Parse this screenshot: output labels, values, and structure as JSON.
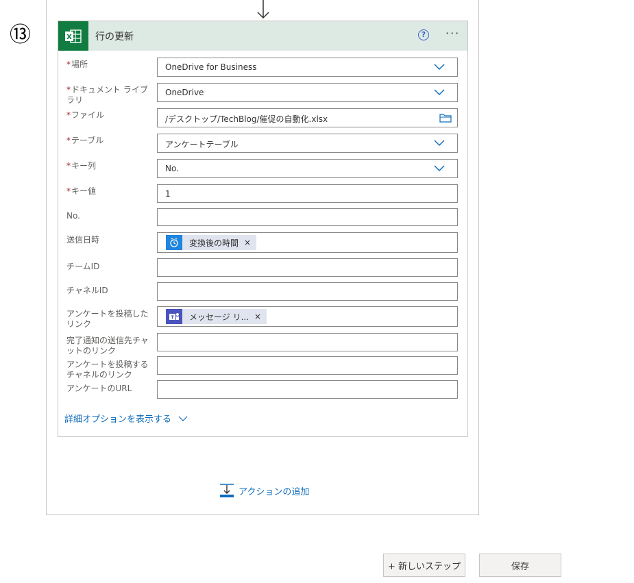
{
  "step_number": "⑬",
  "card": {
    "title": "行の更新",
    "help_label": "?",
    "more_label": "···"
  },
  "fields": {
    "location": {
      "label": "場所",
      "required_mark": "*",
      "value": "OneDrive for Business"
    },
    "library": {
      "label": "ドキュメント ライブラリ",
      "required_mark": "*",
      "value": "OneDrive"
    },
    "file": {
      "label": "ファイル",
      "required_mark": "*",
      "value": "/デスクトップ/TechBlog/催促の自動化.xlsx"
    },
    "table": {
      "label": "テーブル",
      "required_mark": "*",
      "value": "アンケートテーブル"
    },
    "key_column": {
      "label": "キー列",
      "required_mark": "*",
      "value": "No."
    },
    "key_value": {
      "label": "キー値",
      "required_mark": "*",
      "value": "1"
    },
    "no": {
      "label": "No.",
      "value": ""
    },
    "sent_datetime": {
      "label": "送信日時",
      "token": "変換後の時間",
      "token_remove": "×"
    },
    "team_id": {
      "label": "チームID",
      "value": ""
    },
    "channel_id": {
      "label": "チャネルID",
      "value": ""
    },
    "survey_posted_link": {
      "label": "アンケートを投稿したリンク",
      "token": "メッセージ リ...",
      "token_remove": "×"
    },
    "completion_chat_link": {
      "label": "完了通知の送信先チャットのリンク",
      "value": ""
    },
    "survey_channel_link": {
      "label": "アンケートを投稿するチャネルのリンク",
      "value": ""
    },
    "survey_url": {
      "label": "アンケートのURL",
      "value": ""
    }
  },
  "advanced_options": "詳細オプションを表示する",
  "add_action": "アクションの追加",
  "buttons": {
    "new_step": "+ 新しいステップ",
    "save": "保存"
  },
  "colors": {
    "excel_green": "#107c41",
    "header_bg": "#dde9e3",
    "link_blue": "#0f6cbd",
    "required_red": "#a4262c",
    "teams_purple": "#4b53bc",
    "clock_blue": "#1f85de"
  }
}
